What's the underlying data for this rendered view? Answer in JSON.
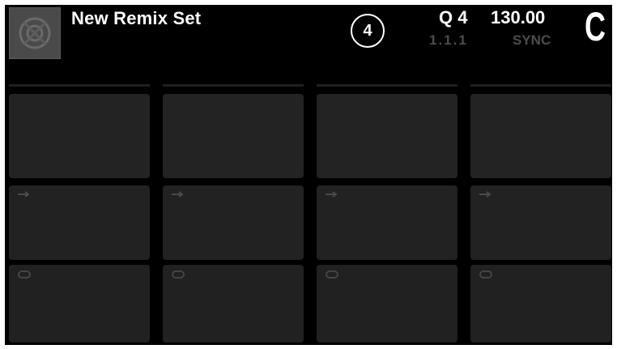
{
  "header": {
    "title": "New Remix Set",
    "deck_number": "4",
    "quantize": "Q 4",
    "tempo": "130.00",
    "beat_position": "1.1.1",
    "sync_label": "SYNC",
    "deck_letter": "C"
  },
  "slots": [
    {
      "id": "slot-1",
      "icons": [
        "arrow-right-icon",
        "loop-icon"
      ]
    },
    {
      "id": "slot-2",
      "icons": [
        "arrow-right-icon",
        "loop-icon"
      ]
    },
    {
      "id": "slot-3",
      "icons": [
        "arrow-right-icon",
        "loop-icon"
      ]
    },
    {
      "id": "slot-4",
      "icons": [
        "arrow-right-icon",
        "loop-icon"
      ]
    }
  ],
  "colors": {
    "background": "#000000",
    "cell": "#232323",
    "dim_text": "#4c4c4c",
    "text": "#ffffff"
  }
}
